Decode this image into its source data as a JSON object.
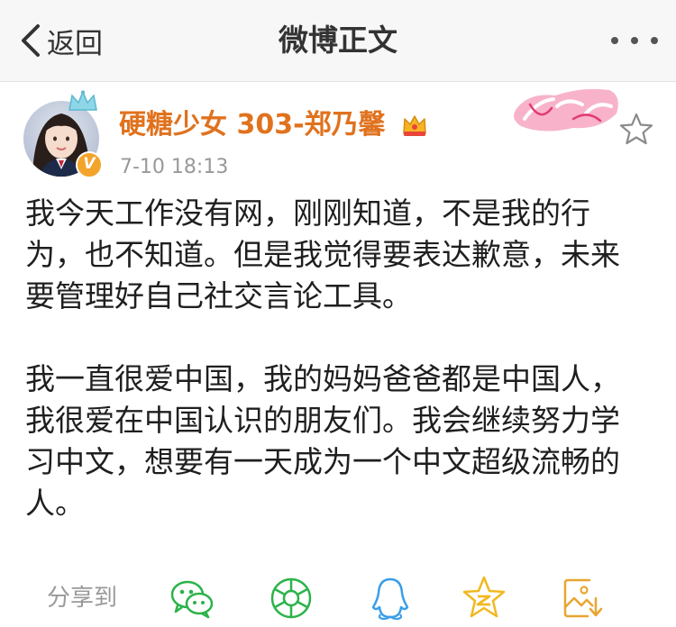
{
  "nav": {
    "back_label": "返回",
    "title": "微博正文"
  },
  "post": {
    "username": "硬糖少女 303-郑乃馨",
    "timestamp": "7-10 18:13",
    "paragraphs": [
      [
        "我今天工作没有网，刚刚知道，不是我的行",
        "为，也不知道。但是我觉得要表达歉意，未来",
        "要管理好自己社交言论工具。"
      ],
      [
        "我一直很爱中国，我的妈妈爸爸都是中国人，",
        "我很爱在中国认识的朋友们。我会继续努力学",
        "习中文，想要有一天成为一个中文超级流畅的",
        "人。"
      ]
    ]
  },
  "share": {
    "label": "分享到",
    "targets": [
      "wechat-icon",
      "moments-icon",
      "qq-icon",
      "qzone-icon",
      "save-image-icon"
    ]
  },
  "colors": {
    "username": "#e0721e",
    "share_icons": "#2bb34a",
    "qq": "#3a9ee8",
    "qzone": "#f2b820",
    "save": "#e8a631"
  }
}
